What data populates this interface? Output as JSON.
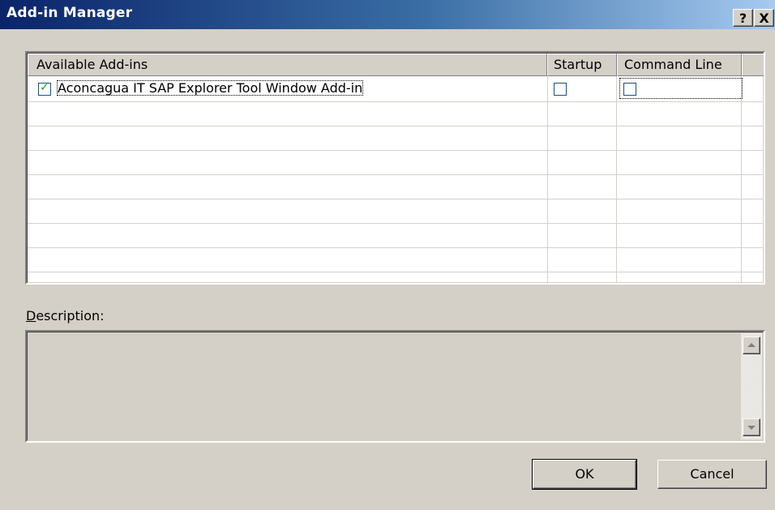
{
  "window": {
    "title": "Add-in Manager",
    "help_label": "?",
    "close_label": "X"
  },
  "list": {
    "columns": [
      "Available Add-ins",
      "Startup",
      "Command Line"
    ],
    "rows": [
      {
        "name": "Aconcagua IT SAP Explorer Tool Window Add-in",
        "loaded": true,
        "startup": false,
        "command_line": false
      }
    ]
  },
  "description": {
    "label_first": "D",
    "label_rest": "escription:",
    "text": ""
  },
  "buttons": {
    "ok": "OK",
    "cancel": "Cancel"
  }
}
